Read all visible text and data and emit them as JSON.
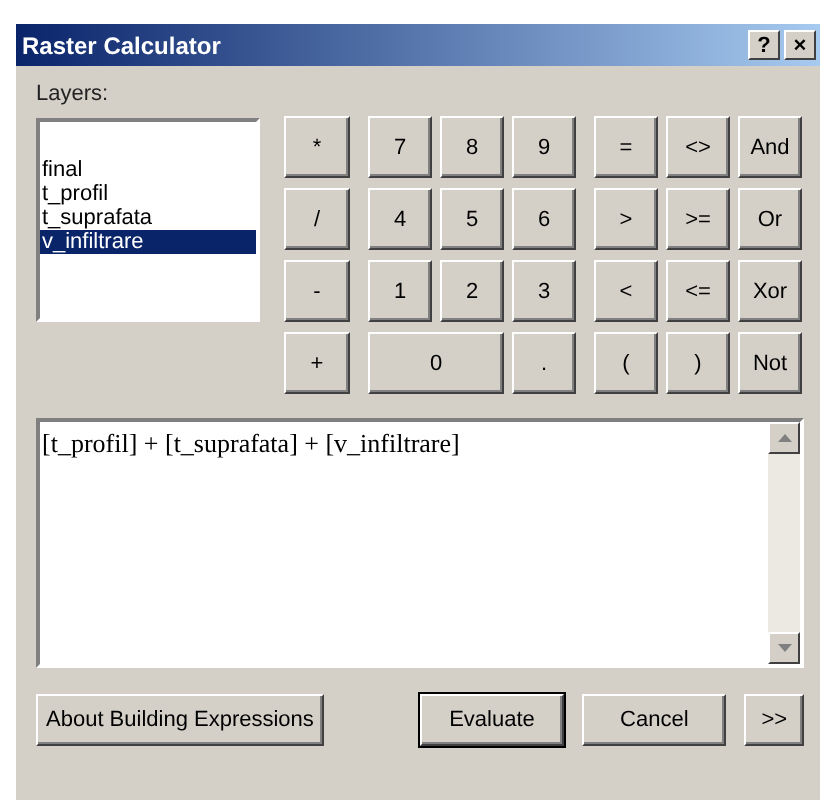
{
  "window": {
    "title": "Raster Calculator",
    "title_buttons": [
      "?",
      "×"
    ]
  },
  "layers": {
    "label": "Layers:",
    "items": [
      {
        "name": "final",
        "selected": false
      },
      {
        "name": "t_profil",
        "selected": false
      },
      {
        "name": "t_suprafata",
        "selected": false
      },
      {
        "name": "v_infiltrare",
        "selected": true
      }
    ]
  },
  "keypad": {
    "operators": [
      "*",
      "/",
      "-",
      "+"
    ],
    "digits": [
      {
        "label": "7",
        "wide": false
      },
      {
        "label": "8",
        "wide": false
      },
      {
        "label": "9",
        "wide": false
      },
      {
        "label": "4",
        "wide": false
      },
      {
        "label": "5",
        "wide": false
      },
      {
        "label": "6",
        "wide": false
      },
      {
        "label": "1",
        "wide": false
      },
      {
        "label": "2",
        "wide": false
      },
      {
        "label": "3",
        "wide": false
      },
      {
        "label": "0",
        "wide": true
      },
      {
        "label": ".",
        "wide": false
      }
    ],
    "logic": [
      "=",
      "<>",
      "And",
      ">",
      ">=",
      "Or",
      "<",
      "<=",
      "Xor",
      "(",
      ")",
      "Not"
    ]
  },
  "expression": {
    "value": "[t_profil] + [t_suprafata] + [v_infiltrare]"
  },
  "buttons": [
    {
      "label": "About Building Expressions",
      "default": false
    },
    {
      "label": "Evaluate",
      "default": true
    },
    {
      "label": "Cancel",
      "default": false
    },
    {
      "label": ">>",
      "default": false
    }
  ]
}
